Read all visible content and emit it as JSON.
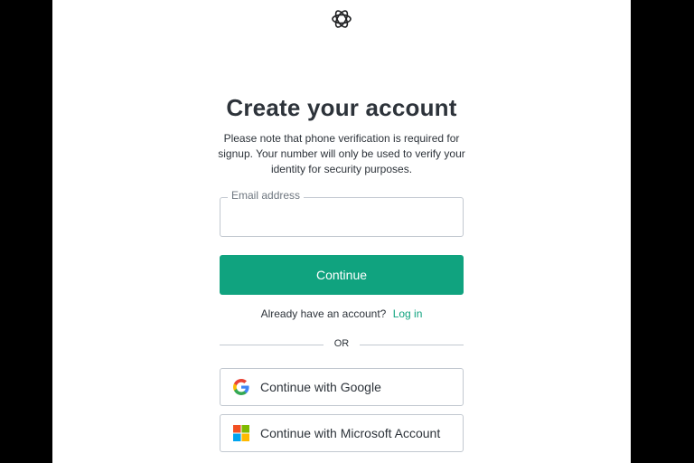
{
  "header": {
    "logo_icon": "openai-logo-icon"
  },
  "main": {
    "title": "Create your account",
    "notice": "Please note that phone verification is required for signup. Your number will only be used to verify your identity for security purposes.",
    "email": {
      "label": "Email address",
      "value": ""
    },
    "continue_label": "Continue",
    "login_prompt": "Already have an account?",
    "login_link": "Log in",
    "divider_text": "OR",
    "google_label": "Continue with Google",
    "microsoft_label": "Continue with Microsoft Account"
  },
  "colors": {
    "accent": "#10a37f",
    "text": "#2d333a",
    "border": "#c2c8d0",
    "background_side": "#000000"
  }
}
